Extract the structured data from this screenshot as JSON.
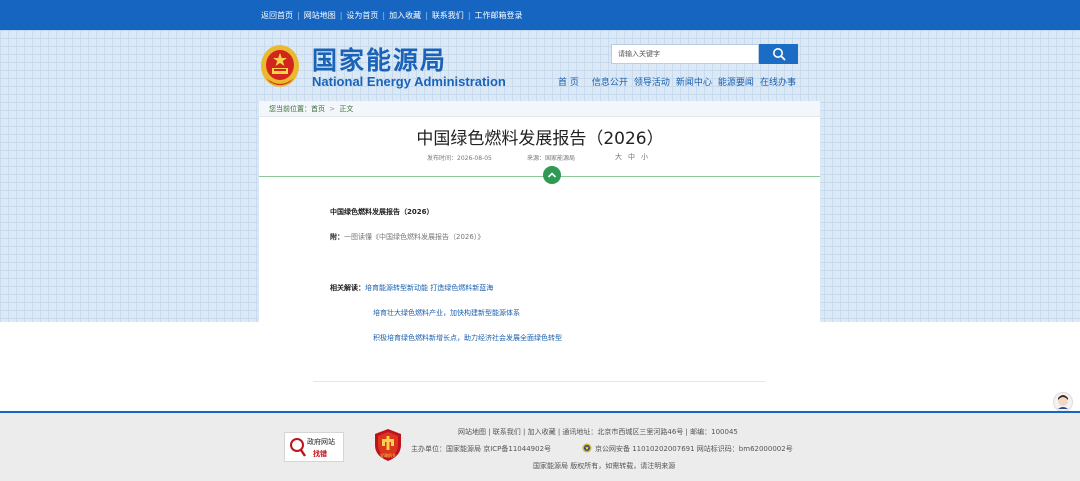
{
  "topbar": {
    "links": [
      "返回首页",
      "网站地图",
      "设为首页",
      "加入收藏",
      "联系我们",
      "工作邮箱登录"
    ]
  },
  "header": {
    "site_name_cn": "国家能源局",
    "site_name_en": "National Energy Administration",
    "search_placeholder": "请输入关键字",
    "nav": [
      "首 页",
      "信息公开",
      "领导活动",
      "新闻中心",
      "能源要闻",
      "在线办事"
    ]
  },
  "breadcrumb": {
    "prefix": "您当前位置：",
    "home": "首页",
    "arrow": ">",
    "current": "正文"
  },
  "article": {
    "title": "中国绿色燃料发展报告（2026）",
    "date": "发布时间：2026-08-05",
    "source": "来源：国家能源局",
    "font_sizes": [
      "大",
      "中",
      "小"
    ],
    "doc_title": "中国绿色燃料发展报告（2026）",
    "attach_label": "附：",
    "attach_link": "一图读懂《中国绿色燃料发展报告（2026）》",
    "related_label": "相关解读：",
    "related_links": [
      "培育能源转型新动能 打造绿色燃料新蓝海",
      "培育壮大绿色燃料产业，加快构建新型能源体系",
      "积极培育绿色燃料新增长点，助力经济社会发展全面绿色转型"
    ]
  },
  "footer": {
    "gov_badge_line1": "政府网站",
    "gov_badge_line2": "找错",
    "party_badge_text": "党政机关",
    "line1": "网站地图 | 联系我们 | 加入收藏 | 通讯地址：北京市西城区三里河路46号 | 邮编：100045",
    "line2_a": "主办单位：国家能源局    京ICP备11044902号",
    "line2_b": "京公网安备 11010202007691    网站标识码：bm62000002号",
    "line3": "国家能源局 版权所有，如需转载，请注明来源"
  },
  "colors": {
    "brand_blue": "#1665c0",
    "link_blue": "#1a5fae",
    "accent_green": "#2e9a54",
    "grid_bg": "#dbe8f5"
  }
}
